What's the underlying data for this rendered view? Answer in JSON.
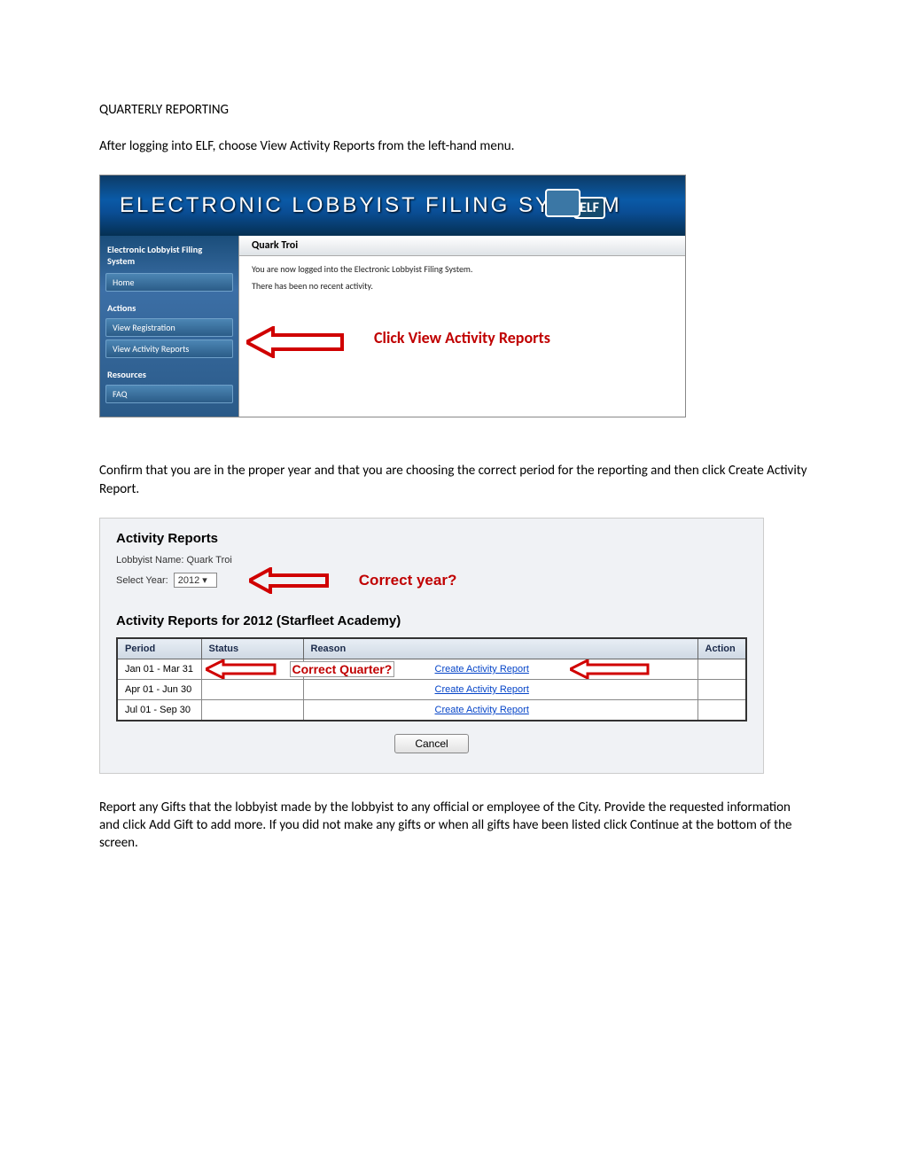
{
  "doc": {
    "heading": "QUARTERLY REPORTING",
    "para1": "After logging into ELF, choose View Activity Reports from the left-hand menu.",
    "para2": "Confirm that you are in the proper year and that you are choosing the correct period for the reporting and then click Create Activity Report.",
    "para3": "Report any Gifts that the lobbyist made by the lobbyist to any official or employee of the City.  Provide the requested information and click Add Gift to add more.  If you did not make any gifts or when all gifts have been listed click Continue at the bottom of the screen."
  },
  "shot1": {
    "banner_title": "ELECTRONIC LOBBYIST FILING SYSTEM",
    "logo_tag": "ELF",
    "sidebar": {
      "title": "Electronic Lobbyist Filing System",
      "home": "Home",
      "actions_label": "Actions",
      "view_registration": "View Registration",
      "view_activity_reports": "View Activity Reports",
      "resources_label": "Resources",
      "faq": "FAQ"
    },
    "content": {
      "username": "Quark Troi",
      "msg1": "You are now logged into the Electronic Lobbyist Filing System.",
      "msg2": "There has been no recent activity."
    },
    "callout": "Click View Activity Reports"
  },
  "shot2": {
    "heading": "Activity Reports",
    "lobbyist_label": "Lobbyist Name: Quark Troi",
    "select_year_label": "Select Year:",
    "selected_year": "2012",
    "subheading": "Activity Reports for 2012 (Starfleet Academy)",
    "cols": {
      "period": "Period",
      "status": "Status",
      "reason": "Reason",
      "action": "Action"
    },
    "rows": [
      {
        "period": "Jan 01 - Mar 31",
        "action": "Create Activity Report"
      },
      {
        "period": "Apr 01 - Jun 30",
        "action": "Create Activity Report"
      },
      {
        "period": "Jul 01 - Sep 30",
        "action": "Create Activity Report"
      }
    ],
    "cancel": "Cancel",
    "annot_year": "Correct year?",
    "annot_quarter": "Correct Quarter?"
  }
}
